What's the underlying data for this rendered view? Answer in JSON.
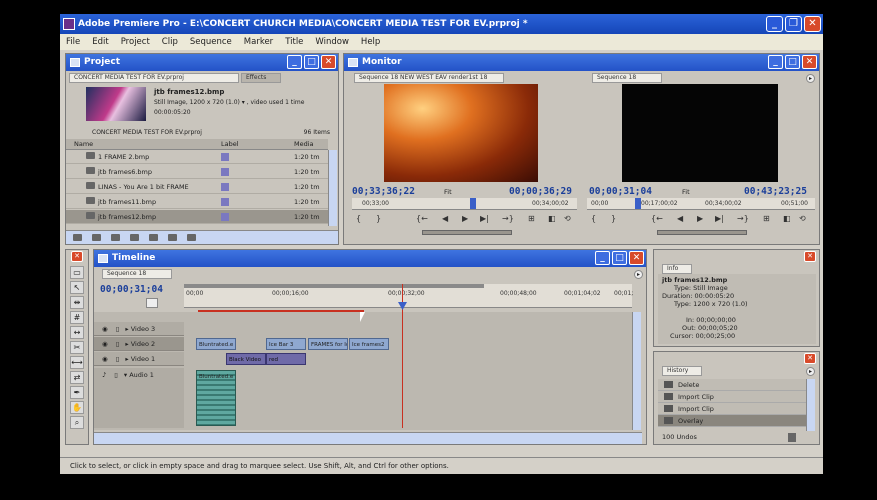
{
  "app": {
    "title": "Adobe Premiere Pro - E:\\CONCERT CHURCH MEDIA\\CONCERT MEDIA TEST FOR EV.prproj *",
    "window_buttons": [
      "_",
      "❐",
      "✕"
    ]
  },
  "menu": [
    "File",
    "Edit",
    "Project",
    "Clip",
    "Sequence",
    "Marker",
    "Title",
    "Window",
    "Help"
  ],
  "project": {
    "title": "Project",
    "tab": "CONCERT MEDIA TEST FOR EV.prproj",
    "tab2": "Effects",
    "preview_name": "jtb frames12.bmp",
    "preview_info1": "Still Image, 1200 x 720 (1.0)  ▾ , video used 1 time",
    "preview_info2": "00:00:05:20",
    "bin_path": "CONCERT MEDIA TEST FOR EV.prproj",
    "items_count": "96 Items",
    "columns": [
      "Name",
      "Label",
      "Media"
    ],
    "rows": [
      {
        "name": "1 FRAME 2.bmp",
        "dur": "1:20 tm"
      },
      {
        "name": "jtb frames6.bmp",
        "dur": "1:20 tm"
      },
      {
        "name": "LINAS - You Are 1 bit FRAME",
        "dur": "1:20 tm"
      },
      {
        "name": "jtb frames11.bmp",
        "dur": "1:20 tm"
      },
      {
        "name": "jtb frames12.bmp",
        "dur": "1:20 tm"
      }
    ]
  },
  "monitor": {
    "title": "Monitor",
    "source_tab": "Sequence 18  NEW WEST EAV render1st 18",
    "program_tab": "Sequence 18",
    "source_tc": "00;33;36;22",
    "source_fit": "Fit",
    "source_dur": "00;00;36;29",
    "source_ruler": [
      "00;33;00",
      "00;34;00;02"
    ],
    "program_tc": "00;00;31;04",
    "program_fit": "Fit",
    "program_dur": "00;43;23;25",
    "program_ruler": [
      "00;00",
      "00;17;00;02",
      "00;34;00;02",
      "00;51;00"
    ],
    "transport": [
      "{",
      "}",
      "{←",
      "◀",
      "▶",
      "▶|",
      "→}",
      "⊞",
      "◧",
      "⟲"
    ]
  },
  "timeline": {
    "title": "Timeline",
    "tab": "Sequence 18",
    "timecode": "00;00;31;04",
    "ruler_labels": [
      "00;00",
      "00;00;16;00",
      "00;00;32;00",
      "00;00;48;00",
      "00;01;04;02",
      "00;01;"
    ],
    "tracks": [
      {
        "name": "Video 3"
      },
      {
        "name": "Video 2"
      },
      {
        "name": "Video 1"
      },
      {
        "name": "Audio 1"
      }
    ],
    "clips_v2": [
      "Bluntrated.e",
      "Ice Bar 3",
      "FRAMES for Ice",
      "Ice frames2"
    ],
    "clips_v1": [
      "Black Video",
      "red"
    ],
    "clips_a1": [
      "Bluntrated.e"
    ]
  },
  "info": {
    "tab": "Info",
    "name": "jtb frames12.bmp",
    "type": "Type: Still Image",
    "duration": "Duration: 00:00:05:20",
    "vtype": "Type: 1200 x 720 (1.0)",
    "in": "In: 00;00;00;00",
    "out": "Out: 00;00;05;20",
    "cursor": "Cursor: 00;00;25;00"
  },
  "history": {
    "tab": "History",
    "items": [
      "Delete",
      "Import Clip",
      "Import Clip",
      "Overlay"
    ],
    "undos": "100 Undos"
  },
  "status": "Click to select, or click in empty space and drag to marquee select. Use Shift, Alt, and Ctrl for other options.",
  "colors": {
    "titlebar": "#2352c7",
    "timecode": "#1a3e9a",
    "playhead": "#c83020",
    "clip_v2": "#8fa8d0",
    "clip_v1": "#6f6aa8",
    "audio": "#5fa8a0"
  }
}
